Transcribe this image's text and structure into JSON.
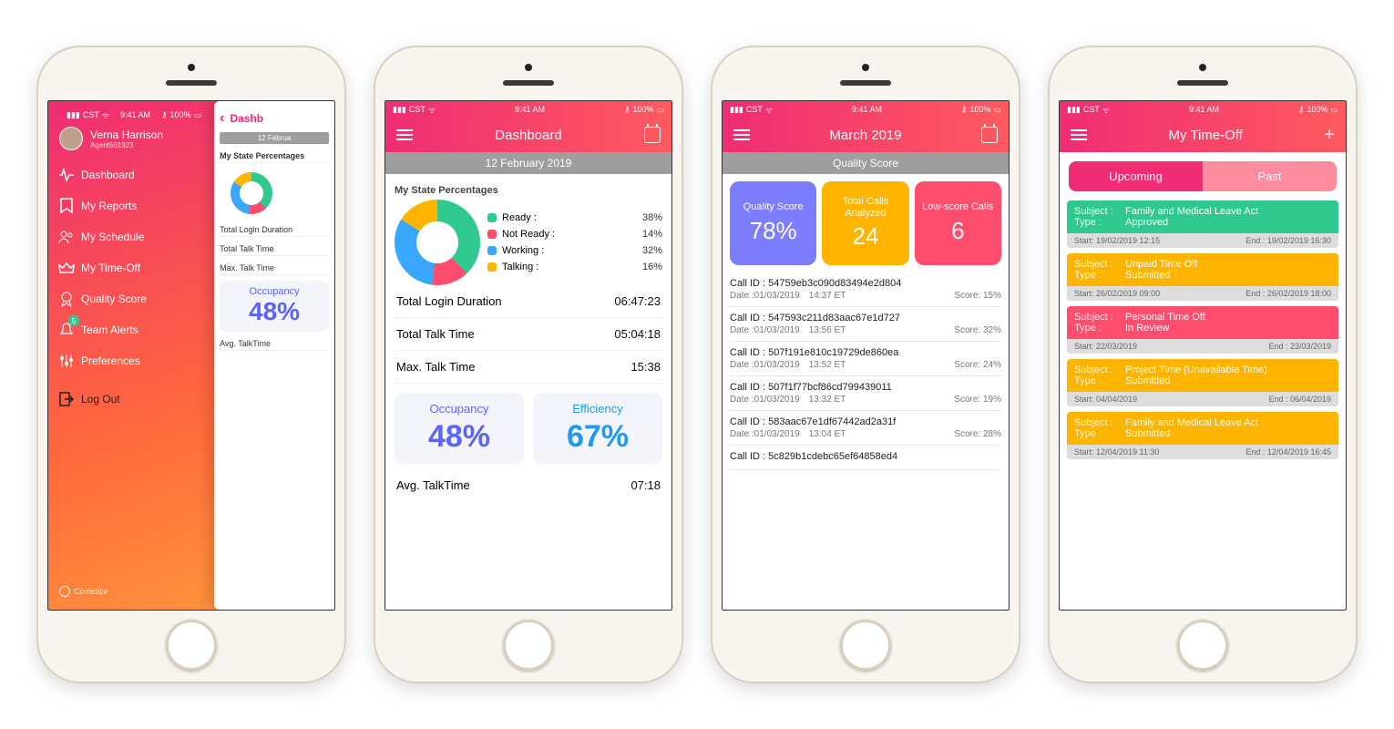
{
  "status_bar": {
    "carrier": "CST",
    "time": "9:41 AM",
    "battery": "100%"
  },
  "colors": {
    "ready": "#2fc98f",
    "notready": "#ff4d6d",
    "working": "#3aa7ff",
    "talking": "#ffb400"
  },
  "chart_data": {
    "type": "pie",
    "title": "My State Percentages",
    "series": [
      {
        "name": "State",
        "values": [
          38,
          14,
          32,
          16
        ]
      }
    ],
    "categories": [
      "Ready",
      "Not Ready",
      "Working",
      "Talking"
    ]
  },
  "phone1": {
    "user": {
      "name": "Verna Harrison",
      "id": "Agent501923"
    },
    "menu": [
      {
        "icon": "pulse",
        "label": "Dashboard"
      },
      {
        "icon": "bookmark",
        "label": "My Reports"
      },
      {
        "icon": "people",
        "label": "My Schedule"
      },
      {
        "icon": "crown",
        "label": "My Time-Off"
      },
      {
        "icon": "rosette",
        "label": "Quality Score"
      },
      {
        "icon": "bell",
        "label": "Team Alerts",
        "badge": "5"
      },
      {
        "icon": "sliders",
        "label": "Preferences"
      },
      {
        "icon": "logout",
        "label": "Log Out",
        "logout": true
      }
    ],
    "brand": "Comstice",
    "peek": {
      "title": "Dashb",
      "date": "12 Februa",
      "section": "My State Percentages",
      "rows": [
        "Total Login Duration",
        "Total Talk Time",
        "Max. Talk Time"
      ],
      "kpi": {
        "label": "Occupancy",
        "value": "48%"
      },
      "avg": "Avg. TalkTime"
    }
  },
  "phone2": {
    "title": "Dashboard",
    "date": "12 February 2019",
    "section": "My State Percentages",
    "legend": [
      {
        "label": "Ready :",
        "value": "38%",
        "color": "#2fc98f"
      },
      {
        "label": "Not Ready :",
        "value": "14%",
        "color": "#ff4d6d"
      },
      {
        "label": "Working :",
        "value": "32%",
        "color": "#3aa7ff"
      },
      {
        "label": "Talking :",
        "value": "16%",
        "color": "#ffb400"
      }
    ],
    "stats": [
      {
        "label": "Total Login Duration",
        "value": "06:47:23"
      },
      {
        "label": "Total Talk Time",
        "value": "05:04:18"
      },
      {
        "label": "Max. Talk Time",
        "value": "15:38"
      }
    ],
    "kpis": [
      {
        "label": "Occupancy",
        "value": "48%"
      },
      {
        "label": "Efficiency",
        "value": "67%"
      }
    ],
    "avg": {
      "label": "Avg. TalkTime",
      "value": "07:18"
    }
  },
  "phone3": {
    "title": "March 2019",
    "subtitle": "Quality Score",
    "cards": [
      {
        "label": "Quality Score",
        "value": "78%"
      },
      {
        "label": "Total Calls Analyzed",
        "value": "24"
      },
      {
        "label": "Low-score Calls",
        "value": "6"
      }
    ],
    "calls": [
      {
        "id": "54759eb3c090d83494e2d804",
        "date": "01/03/2019",
        "time": "14:37 ET",
        "score": "15%"
      },
      {
        "id": "547593c211d83aac67e1d727",
        "date": "01/03/2019",
        "time": "13:56 ET",
        "score": "32%"
      },
      {
        "id": "507f191e810c19729de860ea",
        "date": "01/03/2019",
        "time": "13:52 ET",
        "score": "24%"
      },
      {
        "id": "507f1f77bcf86cd799439011",
        "date": "01/03/2019",
        "time": "13:32 ET",
        "score": "19%"
      },
      {
        "id": "583aac67e1df67442ad2a31f",
        "date": "01/03/2019",
        "time": "13:04 ET",
        "score": "28%"
      },
      {
        "id": "5c829b1cdebc65ef64858ed4",
        "date": "",
        "time": "",
        "score": ""
      }
    ]
  },
  "phone4": {
    "title": "My Time-Off",
    "tabs": {
      "upcoming": "Upcoming",
      "past": "Past"
    },
    "requests": [
      {
        "subject": "Family and Medical Leave Act",
        "type": "Approved",
        "start": "19/02/2019  12:15",
        "end": "19/02/2019  16:30",
        "color": "green"
      },
      {
        "subject": "Unpaid Time Off",
        "type": "Submitted",
        "start": "26/02/2019 09:00",
        "end": "26/02/2019  18:00",
        "color": "yellow"
      },
      {
        "subject": "Personal Time Off",
        "type": "In Review",
        "start": "22/03/2019",
        "end": "23/03/2019",
        "color": "pink"
      },
      {
        "subject": "Project Time (Unavailable Time)",
        "type": "Submitted",
        "start": "04/04/2019",
        "end": "06/04/2019",
        "color": "yellow"
      },
      {
        "subject": "Family and Medical Leave Act",
        "type": "Submitted",
        "start": "12/04/2019  11:30",
        "end": "12/04/2019 16:45",
        "color": "yellow"
      }
    ],
    "labels": {
      "subject": "Subject :",
      "type": "Type :",
      "start": "Start:",
      "end": "End :"
    }
  }
}
